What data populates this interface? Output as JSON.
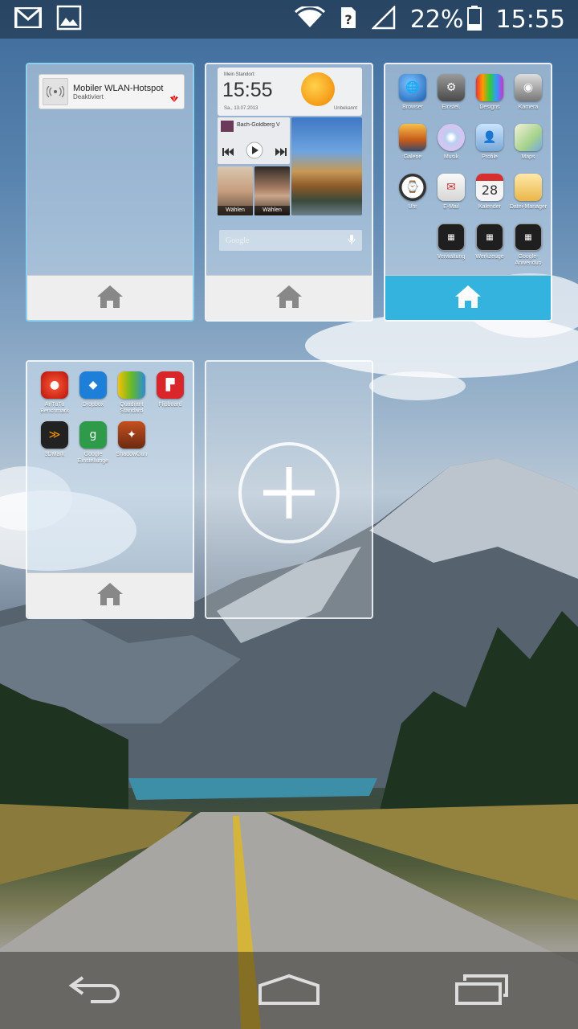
{
  "status_bar": {
    "left_icons": [
      "gmail-icon",
      "gallery-icon"
    ],
    "right_icons": [
      "wifi-icon",
      "sim-icon",
      "signal-icon",
      "battery-icon"
    ],
    "battery": "22%",
    "time": "15:55"
  },
  "screens": [
    {
      "id": 1,
      "widget": {
        "title": "Mobiler WLAN-Hotspot",
        "status": "Deaktiviert"
      },
      "home_icon": "home-icon"
    },
    {
      "id": 2,
      "clock": {
        "location_label": "Mein Standort:",
        "time": "15:55",
        "date": "Sa., 13.07.2013",
        "weather_label": "Unbekannt"
      },
      "music": {
        "track": "Bach-Goldberg V"
      },
      "contacts": [
        "Wählen",
        "Wählen"
      ],
      "search": {
        "placeholder": "Google"
      },
      "home_icon": "home-icon"
    },
    {
      "id": 3,
      "apps": [
        {
          "label": "Browser"
        },
        {
          "label": "Einstel."
        },
        {
          "label": "Designs"
        },
        {
          "label": "Kamera"
        },
        {
          "label": "Galerie"
        },
        {
          "label": "Musik"
        },
        {
          "label": "Profile"
        },
        {
          "label": "Maps"
        },
        {
          "label": "Uhr"
        },
        {
          "label": "E-Mail"
        },
        {
          "label": "Kalender",
          "icon_text": "28"
        },
        {
          "label": "Datei-Manager"
        },
        {
          "label": "Verwaltung"
        },
        {
          "label": "Werkzeuge"
        },
        {
          "label": "Google-Anwendun"
        }
      ],
      "home_icon": "home-icon",
      "selected": true
    },
    {
      "id": 4,
      "apps": [
        {
          "label": "AnTuTu Benchmark"
        },
        {
          "label": "Dropbox"
        },
        {
          "label": "Quadrant Standard"
        },
        {
          "label": "Flipboard"
        },
        {
          "label": "3DMark"
        },
        {
          "label": "Google Einstellunge"
        },
        {
          "label": "ShadowGun"
        }
      ],
      "home_icon": "home-icon"
    }
  ],
  "add_screen": {
    "icon": "plus-icon"
  },
  "nav_bar": {
    "buttons": [
      "back-icon",
      "home-icon",
      "recents-icon"
    ]
  },
  "colors": {
    "selected_footer": "#35b3df",
    "active_border": "#8fd0ef"
  }
}
